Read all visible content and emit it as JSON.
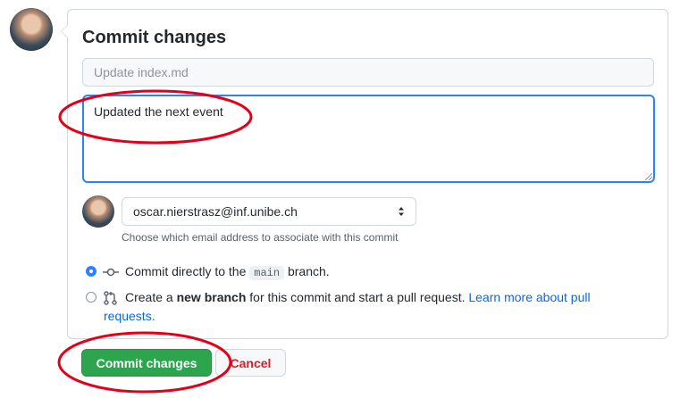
{
  "commit_form": {
    "title": "Commit changes",
    "summary_placeholder": "Update index.md",
    "description_value": "Updated the next event",
    "email": {
      "selected": "oscar.nierstrasz@inf.unibe.ch",
      "hint": "Choose which email address to associate with this commit"
    },
    "options": {
      "direct": {
        "selected": true,
        "prefix": "Commit directly to the ",
        "branch": "main",
        "suffix": " branch."
      },
      "new_branch": {
        "selected": false,
        "prefix": "Create a ",
        "bold": "new branch",
        "middle": " for this commit and start a pull request. ",
        "link_part1": "Learn more about pull",
        "link_part2": "requests."
      }
    },
    "buttons": {
      "commit": "Commit changes",
      "cancel": "Cancel"
    }
  },
  "colors": {
    "primary_button": "#2da44e",
    "focus_border": "#2f81f7",
    "link": "#0969da",
    "cancel_text": "#cf222e",
    "annotation": "#e3001b"
  },
  "icons": [
    "avatar",
    "git-commit-icon",
    "git-pull-request-icon",
    "select-arrows-icon"
  ]
}
